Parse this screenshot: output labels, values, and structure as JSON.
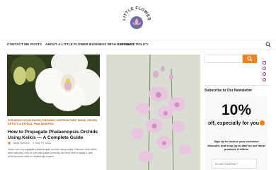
{
  "brand": {
    "logo_arc_text": "LITTLE FLOWER BUSINESS",
    "accent": "#f0821e",
    "icon_color": "#c52e7a"
  },
  "nav": {
    "items": [
      {
        "label": "CONTACT ME"
      },
      {
        "label": "POSTS"
      },
      {
        "label": "ABOUT A LITTLE FLOWER BUSINESS WITH BIG IDEAS"
      },
      {
        "label": "PRIVACY POLICY"
      }
    ],
    "search_icon": "search-icon"
  },
  "post": {
    "categories": "FOR NEWLY GOOD BLOGS, GROWING, HORTICULTURE, IDEAS, ORCHID ARTISTS & EXTRAS, PHALAENOPSIS",
    "title": "How to Propagate Phalaenopsis Orchids Using Keikis — A Complete Guide",
    "author": "Sanja Harrison",
    "date": "May 10, 2023",
    "excerpt": "Learn how to propagate phalaenopsis orchids using keikis. Discover how keikis form naturally, how to use keiki paste correctly, the best time to apply it, and what success rates to realistically expect."
  },
  "sidebar": {
    "search_placeholder": "",
    "social_icons": [
      "instagram-icon",
      "pinterest-icon",
      "youtube-icon",
      "mail-icon"
    ],
    "newsletter_heading": "Subscribe to Our Newsletter",
    "promo_big": "10%",
    "promo_sub": "off, especially for you",
    "promo_text": "Sign up to receive your exclusive discount, and keep up to date on our latest products & offers!",
    "email_placeholder": "Email Address *"
  }
}
